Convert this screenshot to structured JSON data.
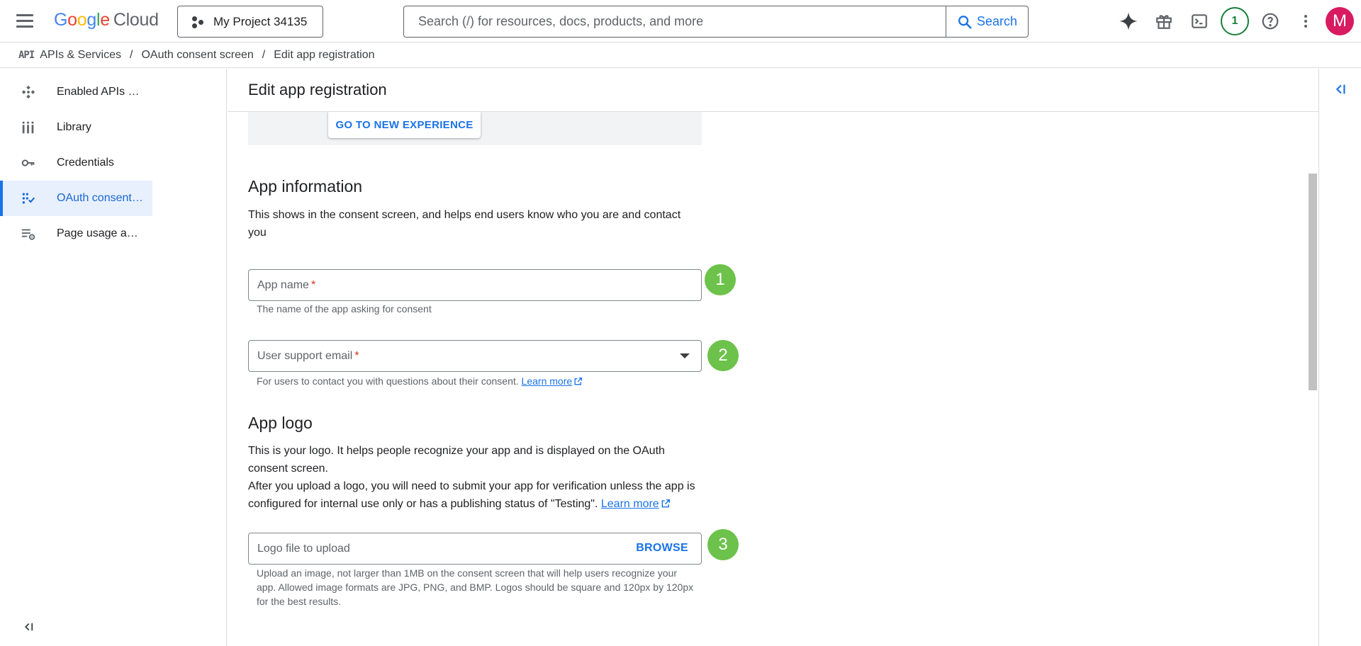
{
  "topbar": {
    "logo_google": [
      "G",
      "o",
      "o",
      "g",
      "l",
      "e"
    ],
    "logo_cloud": "Cloud",
    "project_name": "My Project 34135",
    "search_placeholder": "Search (/) for resources, docs, products, and more",
    "search_button": "Search",
    "notification_count": "1",
    "avatar_letter": "M",
    "icons": [
      "gemini-sparkle-icon",
      "gift-icon",
      "terminal-icon",
      "notification-icon",
      "help-icon",
      "more-vert-icon"
    ]
  },
  "breadcrumb": {
    "api_icon": "API",
    "items": [
      "APIs & Services",
      "OAuth consent screen",
      "Edit app registration"
    ],
    "separator": "/"
  },
  "sidebar": {
    "items": [
      {
        "label": "Enabled APIs …",
        "icon": "api-hub-icon"
      },
      {
        "label": "Library",
        "icon": "library-icon"
      },
      {
        "label": "Credentials",
        "icon": "key-icon"
      },
      {
        "label": "OAuth consent…",
        "icon": "oauth-icon",
        "active": true
      },
      {
        "label": "Page usage a…",
        "icon": "settings-list-icon"
      }
    ]
  },
  "page": {
    "title": "Edit app registration",
    "banner_button": "GO TO NEW EXPERIENCE"
  },
  "app_information": {
    "title": "App information",
    "description": "This shows in the consent screen, and helps end users know who you are and contact you",
    "app_name_label": "App name",
    "required_mark": "*",
    "app_name_hint": "The name of the app asking for consent",
    "support_email_label": "User support email",
    "support_email_hint": "For users to contact you with questions about their consent.",
    "learn_more": "Learn more"
  },
  "app_logo": {
    "title": "App logo",
    "description_1": "This is your logo. It helps people recognize your app and is displayed on the OAuth consent screen.",
    "description_2": "After you upload a logo, you will need to submit your app for verification unless the app is configured for internal use only or has a publishing status of \"Testing\".",
    "learn_more": "Learn more",
    "file_label": "Logo file to upload",
    "browse_button": "BROWSE",
    "hint": "Upload an image, not larger than 1MB on the consent screen that will help users recognize your app. Allowed image formats are JPG, PNG, and BMP. Logos should be square and 120px by 120px for the best results."
  },
  "step_badges": [
    "1",
    "2",
    "3"
  ],
  "colors": {
    "accent": "#1a73e8",
    "active_bg": "#e8f0fe",
    "step_badge": "#6cc24a",
    "required": "#d93025",
    "avatar": "#d81b60"
  }
}
